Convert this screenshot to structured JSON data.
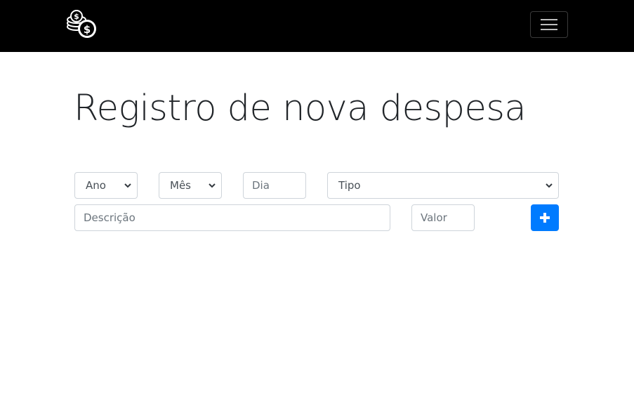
{
  "navbar": {
    "logo_icon": "coins-dollar-icon",
    "toggler_icon": "hamburger-menu-icon"
  },
  "main": {
    "title": "Registro de nova despesa"
  },
  "form": {
    "ano": {
      "selected": "Ano"
    },
    "mes": {
      "selected": "Mês"
    },
    "dia": {
      "placeholder": "Dia"
    },
    "tipo": {
      "selected": "Tipo"
    },
    "descricao": {
      "placeholder": "Descrição"
    },
    "valor": {
      "placeholder": "Valor"
    },
    "add_button_icon": "plus-icon"
  },
  "colors": {
    "navbar_bg": "#000000",
    "primary": "#007bff",
    "border": "#ced4da"
  }
}
